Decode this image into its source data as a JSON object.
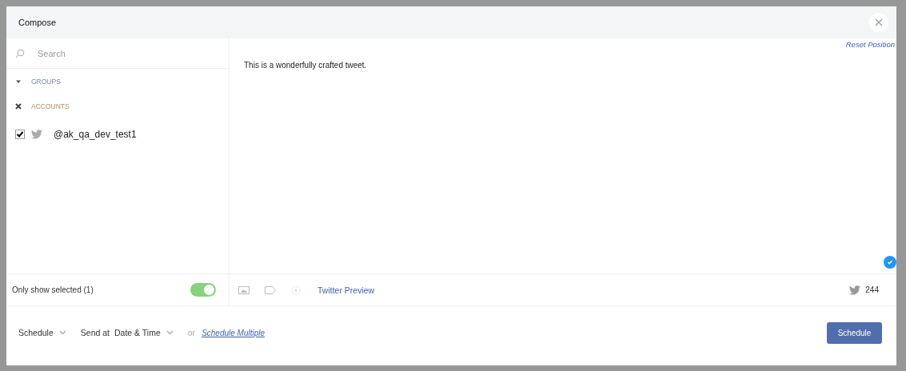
{
  "window": {
    "title": "Compose"
  },
  "sidebar": {
    "search": {
      "placeholder": "Search"
    },
    "sections": [
      {
        "kind": "groups",
        "label": "GROUPS"
      },
      {
        "kind": "accounts",
        "label": "ACCOUNTS"
      }
    ],
    "accounts": [
      {
        "handle": "@ak_qa_dev_test1",
        "checked": true
      }
    ],
    "only_selected": {
      "label": "Only show selected (1)",
      "on": true
    }
  },
  "editor": {
    "reset_link": "Reset Position",
    "text": "This is a wonderfully crafted tweet.",
    "preview_link": "Twitter Preview",
    "count": "244"
  },
  "footer": {
    "schedule_dropdown": "Schedule",
    "send_at_label": "Send at",
    "send_at_value": "Date & Time",
    "or": "or",
    "multiple_link": "Schedule Multiple",
    "button": "Schedule"
  }
}
